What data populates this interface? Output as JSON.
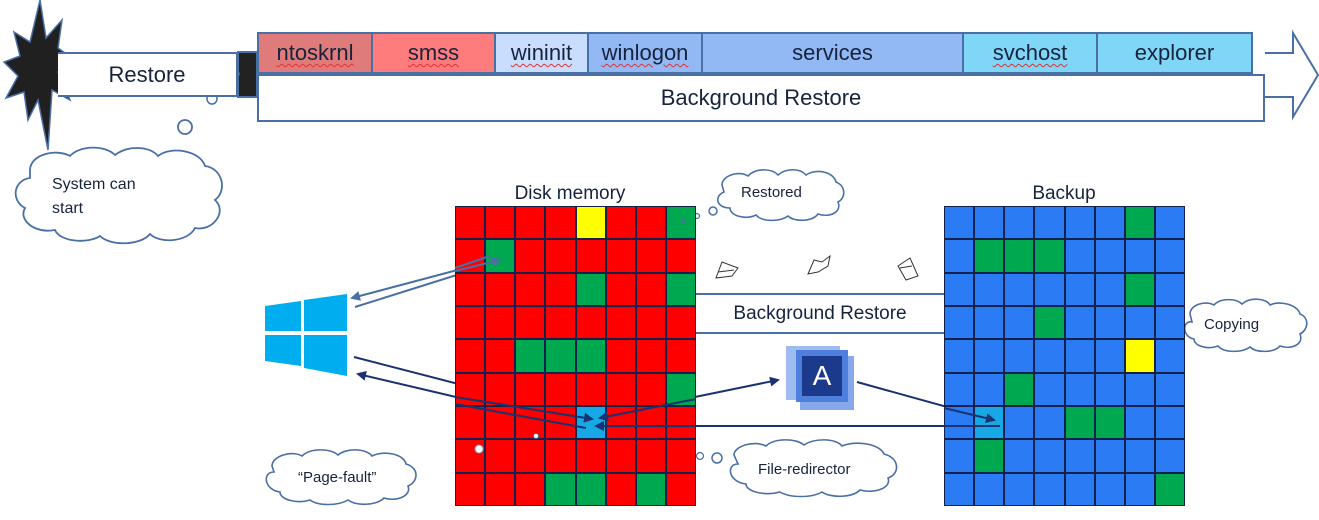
{
  "timeline": {
    "restore_label": "Restore",
    "stages": [
      {
        "label": "ntoskrnl",
        "color": "#e07b7b",
        "spellcheck": true
      },
      {
        "label": "smss",
        "color": "#ff7c7c",
        "spellcheck": true
      },
      {
        "label": "wininit",
        "color": "#c9ddff",
        "spellcheck": true
      },
      {
        "label": "winlogon",
        "color": "#93b9f5",
        "spellcheck": true
      },
      {
        "label": "services",
        "color": "#93b9f5",
        "spellcheck": false
      },
      {
        "label": "svchost",
        "color": "#7fd6f7",
        "spellcheck": true
      },
      {
        "label": "explorer",
        "color": "#7fd6f7",
        "spellcheck": false
      }
    ],
    "background_restore_label": "Background Restore"
  },
  "callouts": {
    "system_can_start": [
      "System can",
      "start"
    ],
    "restored": "Restored",
    "copying": "Copying",
    "page_fault": "“Page-fault”",
    "file_redirector": "File-redirector"
  },
  "disk_memory": {
    "title": "Disk memory",
    "rows": [
      [
        "R",
        "R",
        "R",
        "R",
        "Y",
        "R",
        "R",
        "G"
      ],
      [
        "R",
        "G",
        "R",
        "R",
        "R",
        "R",
        "R",
        "R"
      ],
      [
        "R",
        "R",
        "R",
        "R",
        "G",
        "R",
        "R",
        "G"
      ],
      [
        "R",
        "R",
        "R",
        "R",
        "R",
        "R",
        "R",
        "R"
      ],
      [
        "R",
        "R",
        "G",
        "G",
        "G",
        "R",
        "R",
        "R"
      ],
      [
        "R",
        "R",
        "R",
        "R",
        "R",
        "R",
        "R",
        "G"
      ],
      [
        "R",
        "R",
        "R",
        "R",
        "C",
        "R",
        "R",
        "R"
      ],
      [
        "R",
        "R",
        "R",
        "R",
        "R",
        "R",
        "R",
        "R"
      ],
      [
        "R",
        "R",
        "R",
        "G",
        "G",
        "R",
        "G",
        "R"
      ]
    ]
  },
  "backup": {
    "title": "Backup",
    "rows": [
      [
        "B",
        "B",
        "B",
        "B",
        "B",
        "B",
        "G",
        "B"
      ],
      [
        "B",
        "G",
        "G",
        "G",
        "B",
        "B",
        "B",
        "B"
      ],
      [
        "B",
        "B",
        "B",
        "B",
        "B",
        "B",
        "G",
        "B"
      ],
      [
        "B",
        "B",
        "B",
        "G",
        "B",
        "B",
        "B",
        "B"
      ],
      [
        "B",
        "B",
        "B",
        "B",
        "B",
        "B",
        "Y",
        "B"
      ],
      [
        "B",
        "B",
        "G",
        "B",
        "B",
        "B",
        "B",
        "B"
      ],
      [
        "B",
        "C",
        "B",
        "B",
        "G",
        "G",
        "B",
        "B"
      ],
      [
        "B",
        "G",
        "B",
        "B",
        "B",
        "B",
        "B",
        "B"
      ],
      [
        "B",
        "B",
        "B",
        "B",
        "B",
        "B",
        "B",
        "G"
      ]
    ]
  },
  "middle": {
    "background_restore_label": "Background Restore",
    "app_logo_letter": "A",
    "app_name_icon": "acronis-icon",
    "os_icon": "windows-icon",
    "flying_icons": [
      "page-icon",
      "page-icon",
      "page-icon"
    ]
  },
  "palette": {
    "R": "#ff0000",
    "G": "#00a84f",
    "Y": "#ffff00",
    "C": "#17a9e6",
    "B": "#2b7bf5",
    "line": "#4a6fa5",
    "arrow_dark": "#1a3270",
    "windows_blue": "#00adef"
  }
}
